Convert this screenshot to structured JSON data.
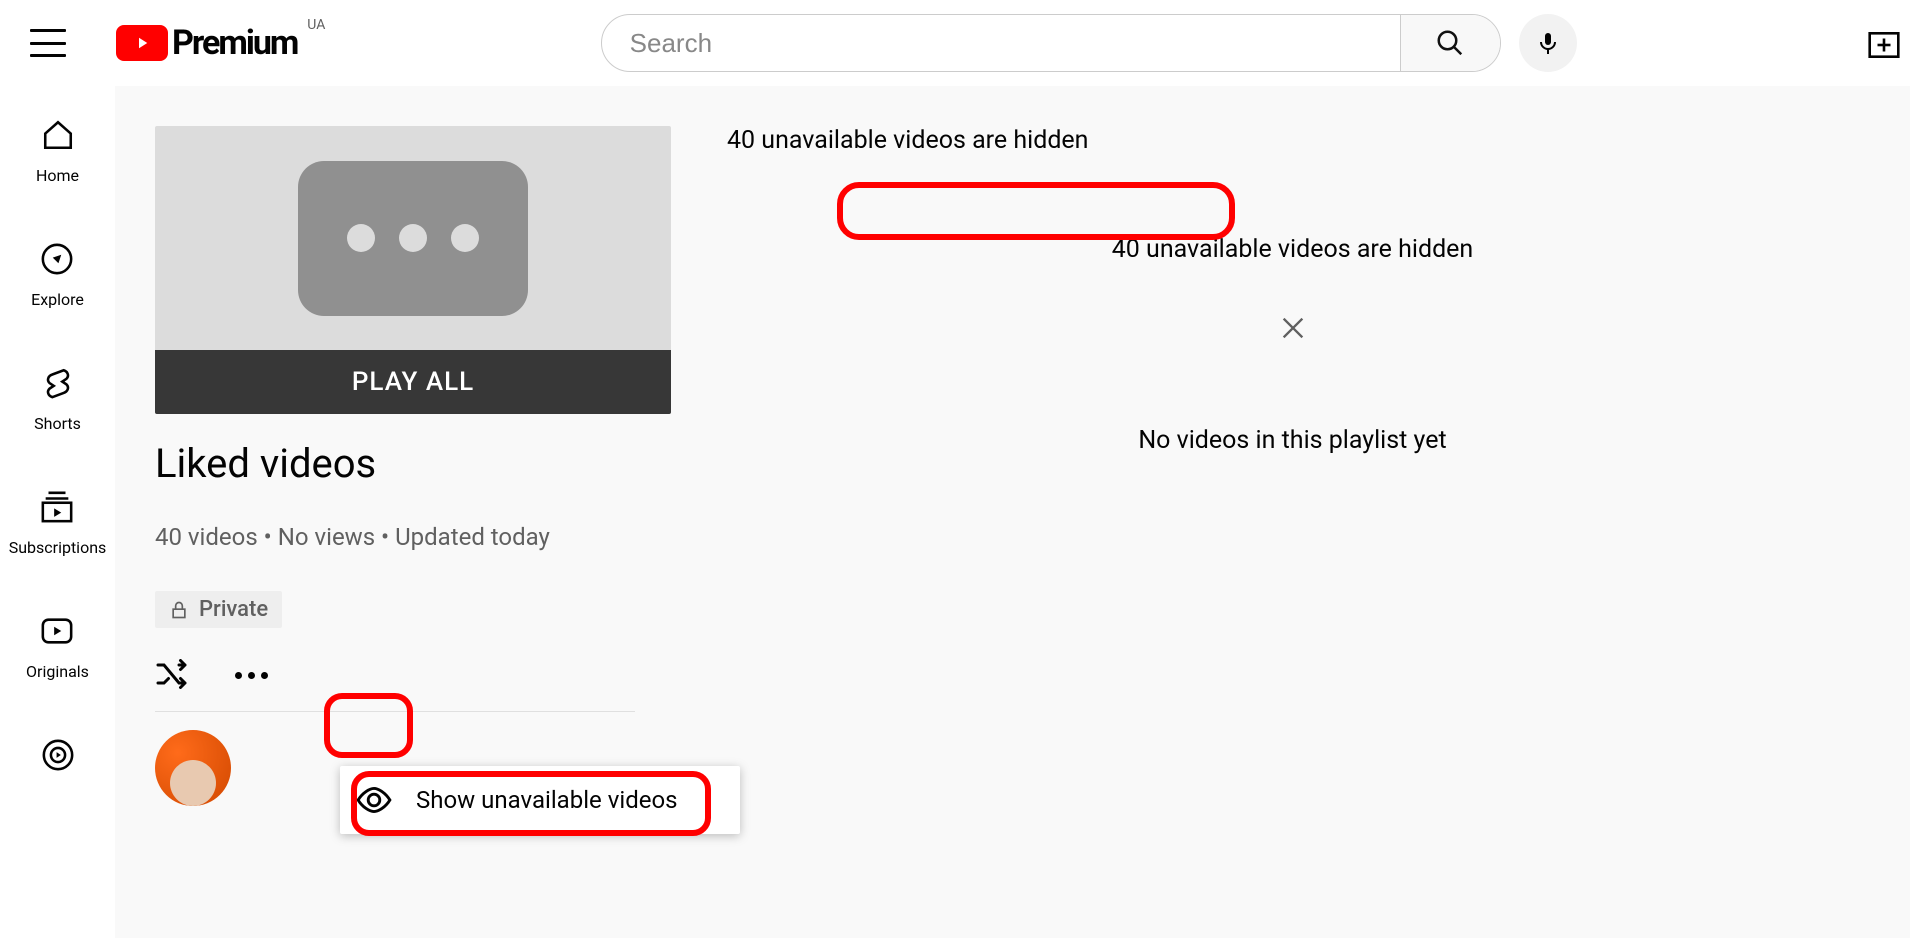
{
  "header": {
    "logo_text": "Premium",
    "region": "UA",
    "search_placeholder": "Search"
  },
  "sidebar": {
    "items": [
      {
        "label": "Home"
      },
      {
        "label": "Explore"
      },
      {
        "label": "Shorts"
      },
      {
        "label": "Subscriptions"
      },
      {
        "label": "Originals"
      }
    ]
  },
  "playlist": {
    "play_all": "PLAY ALL",
    "title": "Liked videos",
    "stats": "40 videos • No views • Updated today",
    "private": "Private",
    "menu_show_unavailable": "Show unavailable videos"
  },
  "right": {
    "banner": "40 unavailable videos are hidden",
    "banner2": "40 unavailable videos are hidden",
    "empty": "No videos in this playlist yet"
  }
}
